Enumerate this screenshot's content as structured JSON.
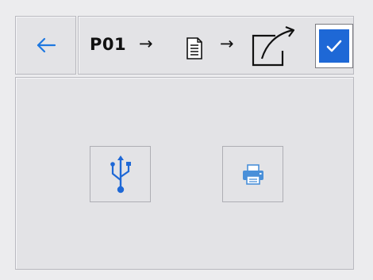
{
  "toolbar": {
    "back": {
      "icon": "back-arrow-icon",
      "color": "#1e78e0"
    },
    "path": {
      "step_label": "P01",
      "separator": "→",
      "steps": [
        "document-icon",
        "export-icon"
      ]
    },
    "confirm": {
      "icon": "check-icon",
      "checked": true,
      "color": "#1e68d6"
    }
  },
  "destinations": [
    {
      "icon": "usb-icon",
      "color": "#1e68d6"
    },
    {
      "icon": "printer-icon",
      "color": "#4a90d9"
    }
  ]
}
